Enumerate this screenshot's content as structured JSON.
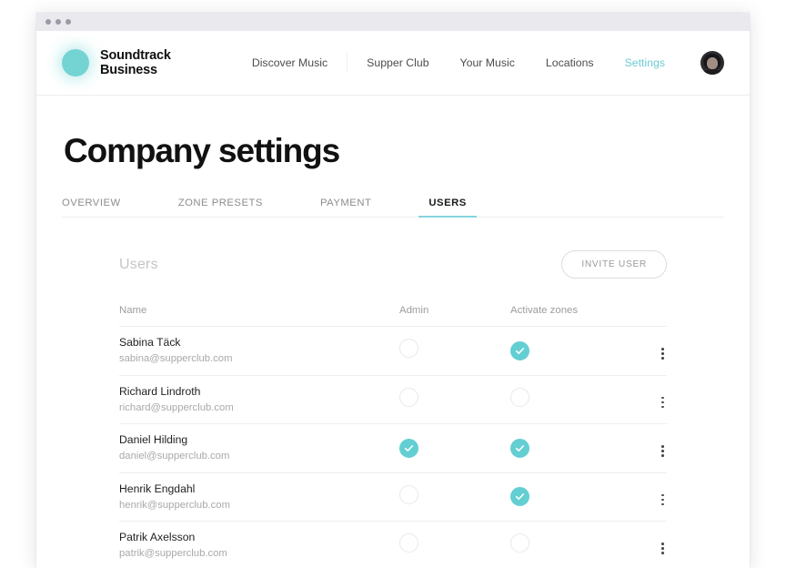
{
  "window": {
    "traffic_lights": [
      "dot-1",
      "dot-2",
      "dot-3"
    ]
  },
  "brand": {
    "line1": "Soundtrack",
    "line2": "Business",
    "logo_color": "#74d4d4"
  },
  "nav": {
    "links": [
      {
        "label": "Discover Music",
        "active": false
      },
      {
        "label": "Supper Club",
        "active": false
      },
      {
        "label": "Your Music",
        "active": false
      },
      {
        "label": "Locations",
        "active": false
      },
      {
        "label": "Settings",
        "active": true
      }
    ],
    "active_color": "#6ecbd5",
    "avatar": "user-avatar"
  },
  "page": {
    "title": "Company settings"
  },
  "tabs": {
    "items": [
      {
        "label": "OVERVIEW",
        "active": false
      },
      {
        "label": "ZONE PRESETS",
        "active": false
      },
      {
        "label": "PAYMENT",
        "active": false
      },
      {
        "label": "USERS",
        "active": true
      }
    ],
    "underline_color": "#86d4de"
  },
  "users_section": {
    "heading": "Users",
    "invite_button": "INVITE USER",
    "columns": {
      "name": "Name",
      "admin": "Admin",
      "zones": "Activate zones"
    },
    "checked_color": "#63cfd2",
    "rows": [
      {
        "name": "Sabina Täck",
        "email": "sabina@supperclub.com",
        "admin": false,
        "activate_zones": true
      },
      {
        "name": "Richard Lindroth",
        "email": "richard@supperclub.com",
        "admin": false,
        "activate_zones": false
      },
      {
        "name": "Daniel Hilding",
        "email": "daniel@supperclub.com",
        "admin": true,
        "activate_zones": true
      },
      {
        "name": "Henrik Engdahl",
        "email": "henrik@supperclub.com",
        "admin": false,
        "activate_zones": true
      },
      {
        "name": "Patrik Axelsson",
        "email": "patrik@supperclub.com",
        "admin": false,
        "activate_zones": false
      }
    ],
    "row_menu_icon": "kebab-menu-icon"
  }
}
